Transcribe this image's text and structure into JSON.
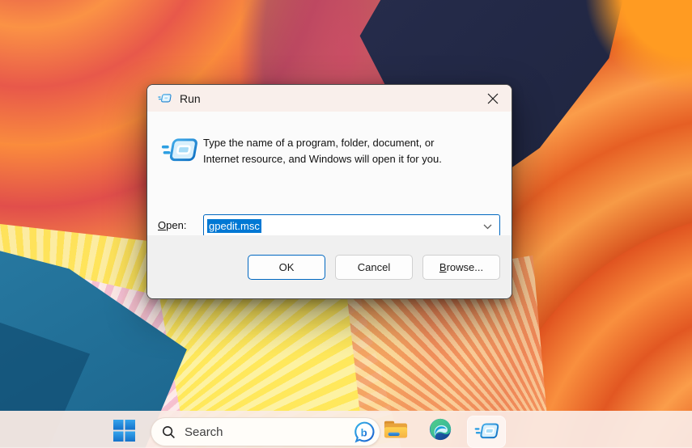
{
  "dialog": {
    "title": "Run",
    "description_line1": "Type the name of a program, folder, document, or",
    "description_line2": "Internet resource, and Windows will open it for you.",
    "open_label_accesskey": "O",
    "open_label_rest": "pen:",
    "open_value": "gpedit.msc",
    "ok_label": "OK",
    "cancel_label": "Cancel",
    "browse_accesskey": "B",
    "browse_rest": "rowse..."
  },
  "taskbar": {
    "search_placeholder": "Search"
  },
  "icons": {
    "dialog_titlebar": "run-icon",
    "dialog_close": "close-icon",
    "dialog_body": "run-icon",
    "combobox": "chevron-down-icon",
    "taskbar": [
      "windows-start-icon",
      "search-icon",
      "bing-icon",
      "file-explorer-icon",
      "edge-icon",
      "run-icon"
    ]
  },
  "colors": {
    "accent": "#0078d4",
    "selection_bg": "#0078d4",
    "default_button_border": "#0067c0",
    "titlebar_bg": "#f9efeb",
    "dialog_body_bg": "#fbfbfb",
    "dialog_footer_bg": "#f0f0f0",
    "taskbar_bg": "#faebe4",
    "wallpaper_palette": [
      "#e14e4b",
      "#fb8c3c",
      "#232947",
      "#ffe94f",
      "#f5bcd8",
      "#1f6b93",
      "#ff9b22"
    ]
  }
}
